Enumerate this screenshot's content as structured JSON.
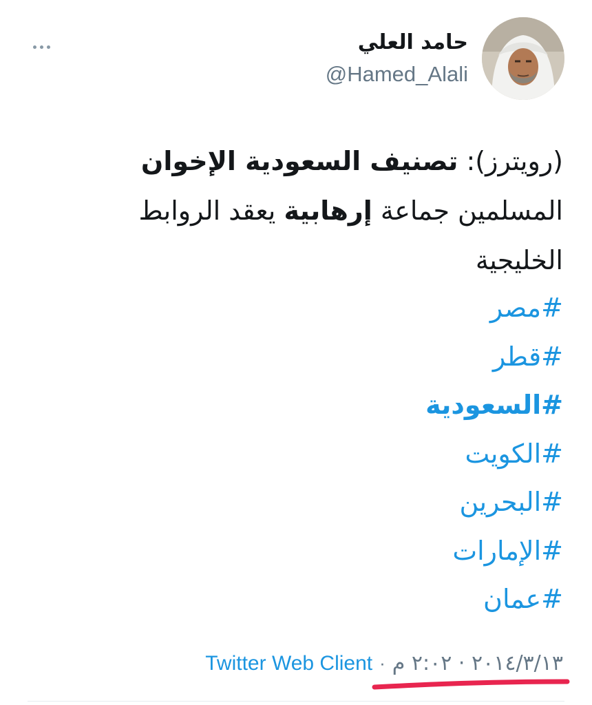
{
  "tweet": {
    "author": {
      "display_name": "حامد العلي",
      "handle": "@Hamed_Alali"
    },
    "text": {
      "line1_plain": "(رويترز): ",
      "line1_bold": "تصنيف السعودية الإخوان",
      "line2_part1": "المسلمين جماعة ",
      "line2_bold": "إرهابية",
      "line2_part2": " يعقد الروابط",
      "line3": "الخليجية"
    },
    "hashtags": [
      {
        "label": "#مصر",
        "bold": false
      },
      {
        "label": "#قطر",
        "bold": false
      },
      {
        "label": "#السعودية",
        "bold": true
      },
      {
        "label": "#الكويت",
        "bold": false
      },
      {
        "label": "#البحرين",
        "bold": false
      },
      {
        "label": "#الإمارات",
        "bold": false
      },
      {
        "label": "#عمان",
        "bold": false
      }
    ],
    "meta": {
      "timestamp": "٢٠١٤/٣/١٣ · ٢:٠٢ م",
      "separator": "·",
      "source": "Twitter Web Client"
    },
    "icons": {
      "more": "more-horizontal-icon"
    },
    "colors": {
      "link": "#1b95e0",
      "muted": "#657786",
      "text": "#14171a",
      "highlight_underline": "#e8254f"
    }
  }
}
